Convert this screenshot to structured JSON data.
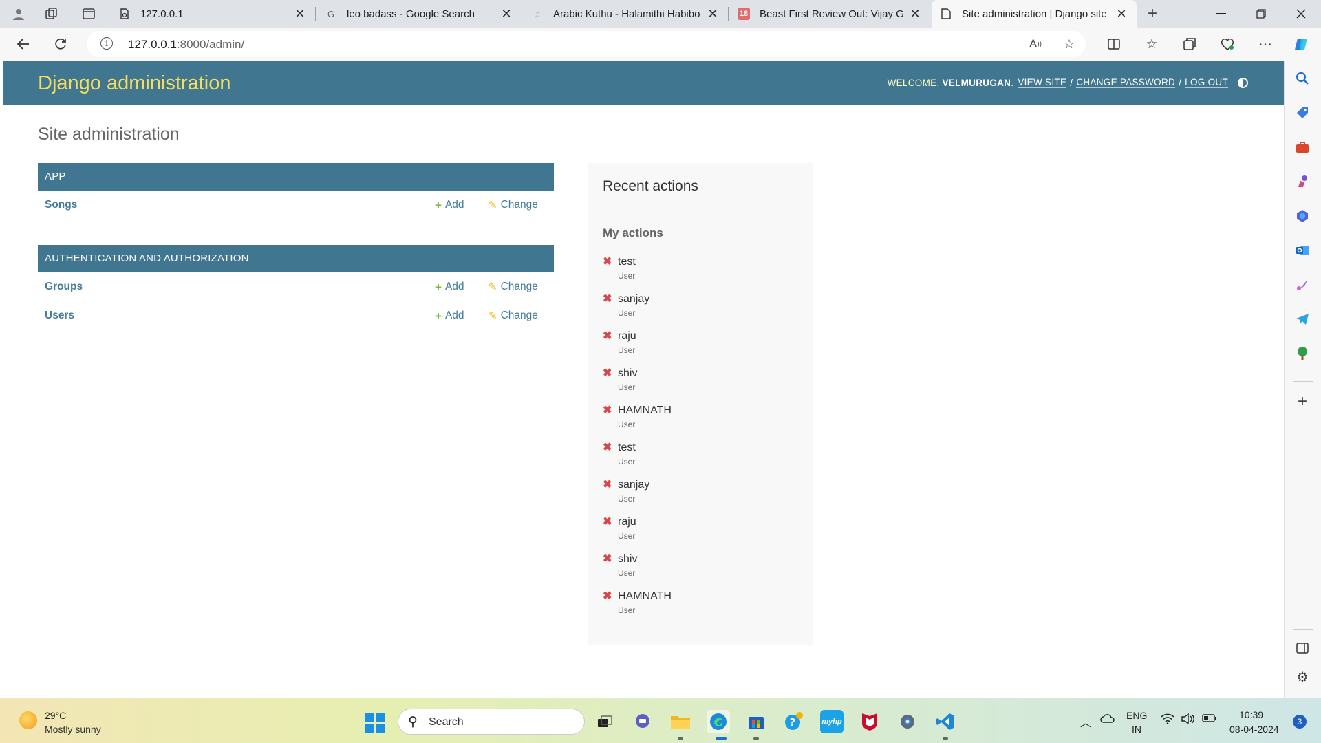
{
  "browser": {
    "tabs": [
      {
        "title": "127.0.0.1",
        "favicon": "page-lock-icon"
      },
      {
        "title": "leo badass - Google Search",
        "favicon": "google-icon"
      },
      {
        "title": "Arabic Kuthu - Halamithi Habibo",
        "favicon": "music-icon"
      },
      {
        "title": "Beast First Review Out: Vijay Give",
        "favicon": "news18-icon"
      },
      {
        "title": "Site administration | Django site",
        "favicon": "page-icon"
      }
    ],
    "favicon_text_18": "18",
    "url_host": "127.0.0.1",
    "url_rest": ":8000/admin/"
  },
  "header": {
    "brand": "Django administration",
    "welcome": "WELCOME,",
    "username": "VELMURUGAN",
    "view_site": "VIEW SITE",
    "change_password": "CHANGE PASSWORD",
    "log_out": "LOG OUT",
    "sep": "/",
    "period": "."
  },
  "content": {
    "title": "Site administration",
    "modules": [
      {
        "caption": "APP",
        "models": [
          {
            "name": "Songs",
            "add": "Add",
            "change": "Change"
          }
        ]
      },
      {
        "caption": "AUTHENTICATION AND AUTHORIZATION",
        "models": [
          {
            "name": "Groups",
            "add": "Add",
            "change": "Change"
          },
          {
            "name": "Users",
            "add": "Add",
            "change": "Change"
          }
        ]
      }
    ]
  },
  "recent": {
    "title": "Recent actions",
    "subtitle": "My actions",
    "actions": [
      {
        "object": "test",
        "type": "User"
      },
      {
        "object": "sanjay",
        "type": "User"
      },
      {
        "object": "raju",
        "type": "User"
      },
      {
        "object": "shiv",
        "type": "User"
      },
      {
        "object": "HAMNATH",
        "type": "User"
      },
      {
        "object": "test",
        "type": "User"
      },
      {
        "object": "sanjay",
        "type": "User"
      },
      {
        "object": "raju",
        "type": "User"
      },
      {
        "object": "shiv",
        "type": "User"
      },
      {
        "object": "HAMNATH",
        "type": "User"
      }
    ]
  },
  "taskbar": {
    "temperature": "29°C",
    "condition": "Mostly sunny",
    "search_label": "Search",
    "lang_top": "ENG",
    "lang_bottom": "IN",
    "time": "10:39",
    "date": "08-04-2024",
    "notifications": "3"
  },
  "colors": {
    "django_header": "#417690",
    "django_brand": "#f5dd5d",
    "link": "#447e9b",
    "add_icon": "#70bf2b",
    "change_icon": "#efb80b",
    "delete_icon": "#dd4646"
  }
}
